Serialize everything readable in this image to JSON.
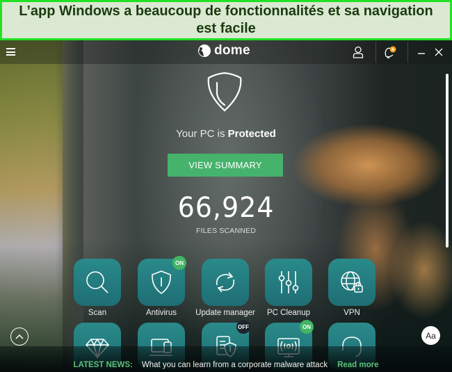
{
  "caption": "L’app Windows a beaucoup de fonctionnalités et sa navigation est facile",
  "app": {
    "brand": "dome",
    "topbar": {
      "menu_icon": "hamburger-icon",
      "account_icon": "user-icon",
      "notifications_icon": "bell-icon",
      "minimize_icon": "minimize-icon",
      "close_icon": "close-icon"
    },
    "status": {
      "prefix": "Your PC is ",
      "state": "Protected"
    },
    "view_summary_label": "VIEW SUMMARY",
    "files_scanned": {
      "count": "66,924",
      "label": "FILES SCANNED"
    },
    "tiles": [
      {
        "label": "Scan",
        "icon": "search-icon",
        "badge": null
      },
      {
        "label": "Antivirus",
        "icon": "shield-icon",
        "badge": "ON"
      },
      {
        "label": "Update manager",
        "icon": "refresh-icon",
        "badge": null
      },
      {
        "label": "PC Cleanup",
        "icon": "sliders-icon",
        "badge": null
      },
      {
        "label": "VPN",
        "icon": "globe-lock-icon",
        "badge": null
      },
      {
        "label": "",
        "icon": "diamond-icon",
        "badge": null
      },
      {
        "label": "",
        "icon": "devices-icon",
        "badge": null
      },
      {
        "label": "",
        "icon": "document-shield-icon",
        "badge": "OFF"
      },
      {
        "label": "",
        "icon": "wifi-monitor-icon",
        "badge": "ON"
      },
      {
        "label": "",
        "icon": "headset-icon",
        "badge": null
      }
    ],
    "news": {
      "label": "LATEST NEWS:",
      "headline": "What you can learn from a corporate malware attack",
      "link": "Read more"
    },
    "font_size_button": "Aa",
    "colors": {
      "accent_green": "#45b36b",
      "tile_teal": "#23797d",
      "notification_dot": "#f5a623"
    }
  }
}
